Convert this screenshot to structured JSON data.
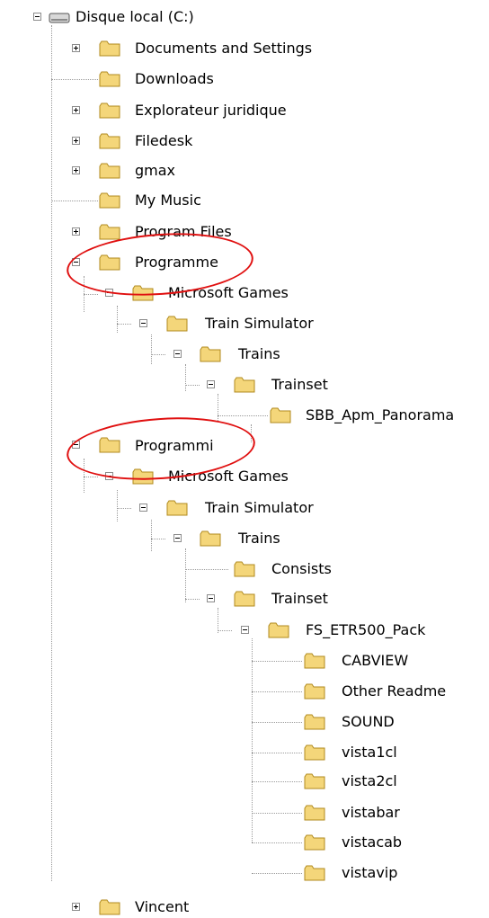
{
  "tree": {
    "root": {
      "label": "Disque local (C:)",
      "icon": "hard-drive-icon"
    },
    "items": [
      {
        "label": "Documents and Settings",
        "icon": "folder-icon",
        "toggle": "plus"
      },
      {
        "label": "Downloads",
        "icon": "folder-icon",
        "toggle": "none"
      },
      {
        "label": "Explorateur juridique",
        "icon": "folder-icon",
        "toggle": "plus"
      },
      {
        "label": "Filedesk",
        "icon": "folder-icon",
        "toggle": "plus"
      },
      {
        "label": "gmax",
        "icon": "folder-icon",
        "toggle": "plus"
      },
      {
        "label": "My Music",
        "icon": "folder-icon",
        "toggle": "none"
      },
      {
        "label": "Program Files",
        "icon": "folder-icon",
        "toggle": "plus"
      },
      {
        "label": "Programme",
        "icon": "folder-icon",
        "toggle": "minus",
        "highlighted": true
      },
      {
        "label": "Microsoft Games",
        "icon": "folder-icon",
        "toggle": "minus"
      },
      {
        "label": "Train Simulator",
        "icon": "folder-icon",
        "toggle": "minus"
      },
      {
        "label": "Trains",
        "icon": "folder-icon",
        "toggle": "minus"
      },
      {
        "label": "Trainset",
        "icon": "folder-icon",
        "toggle": "minus"
      },
      {
        "label": "SBB_Apm_Panorama",
        "icon": "folder-icon",
        "toggle": "none"
      },
      {
        "label": "Programmi",
        "icon": "folder-icon",
        "toggle": "minus",
        "highlighted": true
      },
      {
        "label": "Microsoft Games",
        "icon": "folder-icon",
        "toggle": "minus"
      },
      {
        "label": "Train Simulator",
        "icon": "folder-icon",
        "toggle": "minus"
      },
      {
        "label": "Trains",
        "icon": "folder-icon",
        "toggle": "minus"
      },
      {
        "label": "Consists",
        "icon": "folder-icon",
        "toggle": "none"
      },
      {
        "label": "Trainset",
        "icon": "folder-icon",
        "toggle": "minus"
      },
      {
        "label": "FS_ETR500_Pack",
        "icon": "folder-icon",
        "toggle": "minus"
      },
      {
        "label": "CABVIEW",
        "icon": "folder-icon",
        "toggle": "none"
      },
      {
        "label": "Other Readme",
        "icon": "folder-icon",
        "toggle": "none"
      },
      {
        "label": "SOUND",
        "icon": "folder-icon",
        "toggle": "none"
      },
      {
        "label": "vista1cl",
        "icon": "folder-icon",
        "toggle": "none"
      },
      {
        "label": "vista2cl",
        "icon": "folder-icon",
        "toggle": "none"
      },
      {
        "label": "vistabar",
        "icon": "folder-icon",
        "toggle": "none"
      },
      {
        "label": "vistacab",
        "icon": "folder-icon",
        "toggle": "none"
      },
      {
        "label": "vistavip",
        "icon": "folder-icon",
        "toggle": "none"
      },
      {
        "label": "Vincent",
        "icon": "folder-icon",
        "toggle": "plus"
      }
    ]
  },
  "colors": {
    "folder_fill": "#f4d67a",
    "folder_edge": "#b08a1e",
    "highlight_ring": "#e01010",
    "tree_line": "#9a9a9a"
  }
}
